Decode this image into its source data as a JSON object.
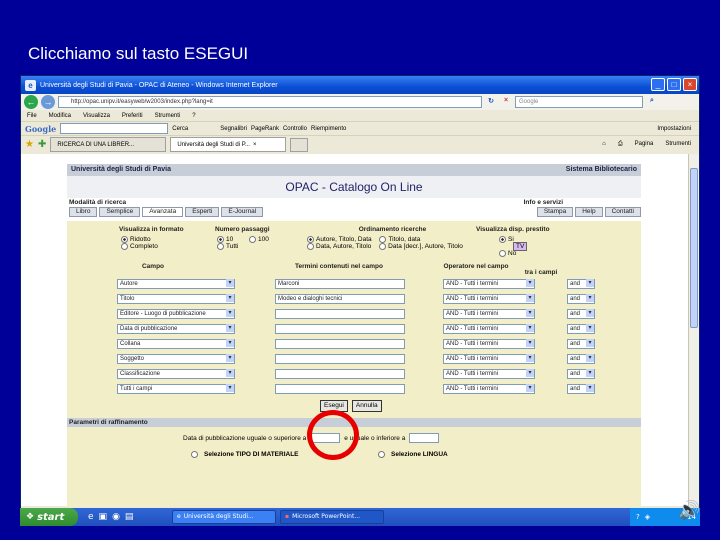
{
  "slide": {
    "title": "Clicchiamo sul tasto ESEGUI"
  },
  "window": {
    "title": "Università degli Studi di Pavia - OPAC di Ateneo - Windows Internet Explorer",
    "address": "http://opac.unipv.it/easyweb/w2003/index.php?lang=it",
    "search_placeholder": "Google",
    "menu": [
      "File",
      "Modifica",
      "Visualizza",
      "Preferiti",
      "Strumenti",
      "?"
    ],
    "google_label": "Google",
    "google_items": [
      "Cerca",
      "Segnalibri",
      "PageRank",
      "Controllo",
      "Riempimento"
    ],
    "google_settings": "Impostazioni",
    "tabs": [
      {
        "label": "RICERCA DI UNA LIBRER..."
      },
      {
        "label": "Università degli Studi di P..."
      }
    ],
    "tab_tools": [
      "Pagina",
      "Strumenti"
    ]
  },
  "opac": {
    "university": "Università degli Studi di Pavia",
    "system": "Sistema Bibliotecario",
    "title": "OPAC - Catalogo On Line",
    "mode_label": "Modalità di ricerca",
    "info_label": "Info e servizi",
    "mode_buttons": [
      "Libro",
      "Semplice",
      "Avanzata",
      "Esperti",
      "E-Journal"
    ],
    "info_buttons": [
      "Stampa",
      "Help",
      "Contatti"
    ],
    "format_label": "Visualizza in formato",
    "format_options": [
      "Ridotto",
      "Completo"
    ],
    "count_label": "Numero passaggi",
    "count_options": [
      "10",
      "100",
      "Tutti"
    ],
    "order_label": "Ordinamento ricerche",
    "order_options": [
      "Autore, Titolo, Data",
      "Titolo, data",
      "Data, Autore, Titolo",
      "Data [decr.], Autore, Titolo"
    ],
    "loan_label": "Visualizza disp. prestito",
    "loan_options": [
      "Si",
      "No"
    ],
    "tv_label": "TV",
    "col_campo": "Campo",
    "col_termini": "Termini contenuti nel campo",
    "col_operatore": "Operatore nel campo",
    "col_tra": "tra i campi",
    "rows": [
      {
        "field": "Autore",
        "term": "Marconi",
        "op": "AND - Tutti i termini",
        "join": "and"
      },
      {
        "field": "Titolo",
        "term": "Modeo e dialoghi tecnici",
        "op": "AND - Tutti i termini",
        "join": "and"
      },
      {
        "field": "Editore - Luogo di pubblicazione",
        "term": "",
        "op": "AND - Tutti i termini",
        "join": "and"
      },
      {
        "field": "Data di pubblicazione",
        "term": "",
        "op": "AND - Tutti i termini",
        "join": "and"
      },
      {
        "field": "Collana",
        "term": "",
        "op": "AND - Tutti i termini",
        "join": "and"
      },
      {
        "field": "Soggetto",
        "term": "",
        "op": "AND - Tutti i termini",
        "join": "and"
      },
      {
        "field": "Classificazione",
        "term": "",
        "op": "AND - Tutti i termini",
        "join": "and"
      },
      {
        "field": "Tutti i campi",
        "term": "",
        "op": "AND - Tutti i termini",
        "join": "and"
      }
    ],
    "esegui_label": "Esegui",
    "annulla_label": "Annulla",
    "refine_label": "Parametri di raffinamento",
    "date_label": "Data di pubblicazione uguale o superiore a",
    "date_label2": "e uguale o inferiore a",
    "material_label": "Selezione TIPO DI MATERIALE",
    "language_label": "Selezione LINGUA"
  },
  "taskbar": {
    "start": "start",
    "tasks": [
      "Università degli Studi...",
      "Microsoft PowerPoint..."
    ],
    "clock": "14"
  }
}
